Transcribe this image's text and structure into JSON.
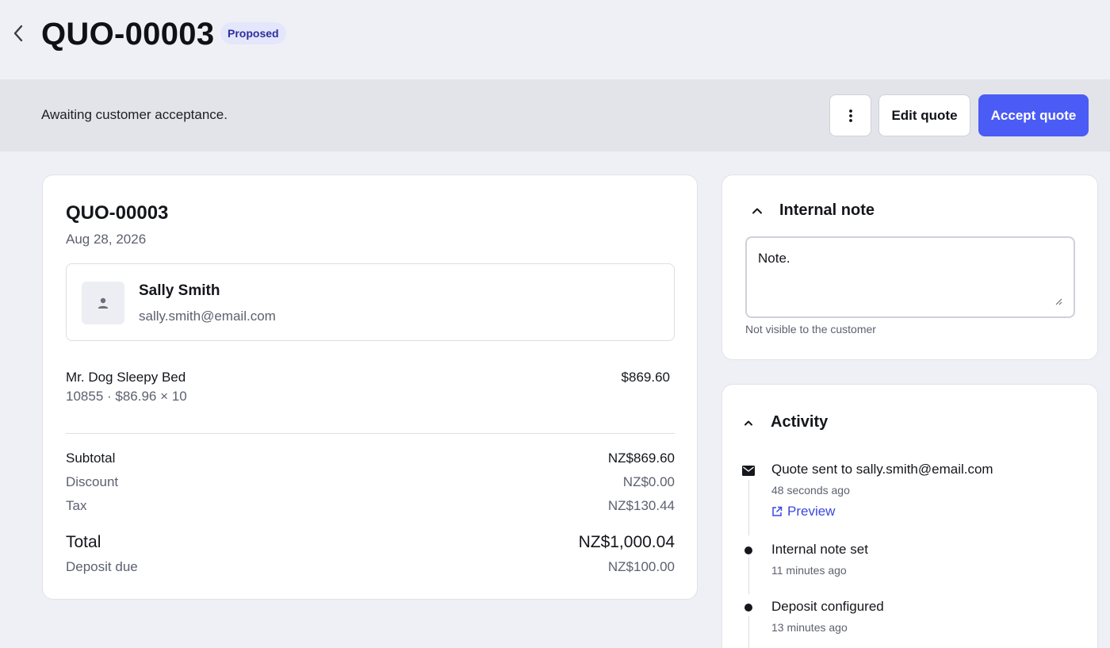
{
  "header": {
    "title": "QUO-00003",
    "status": "Proposed",
    "colors": {
      "badge_bg": "#e4e7fb",
      "badge_text": "#2b2f9e"
    }
  },
  "banner": {
    "message": "Awaiting customer acceptance.",
    "edit_label": "Edit quote",
    "accept_label": "Accept quote",
    "accent_color": "#4b5bf5"
  },
  "quote": {
    "number": "QUO-00003",
    "date": "Aug 28, 2026",
    "customer": {
      "name": "Sally Smith",
      "email": "sally.smith@email.com"
    },
    "line_item": {
      "name": "Mr. Dog Sleepy Bed",
      "meta": "10855 · $86.96 × 10",
      "price": "$869.60"
    },
    "summary": {
      "subtotal_label": "Subtotal",
      "subtotal_value": "NZ$869.60",
      "discount_label": "Discount",
      "discount_value": "NZ$0.00",
      "tax_label": "Tax",
      "tax_value": "NZ$130.44",
      "total_label": "Total",
      "total_value": "NZ$1,000.04",
      "deposit_label": "Deposit due",
      "deposit_value": "NZ$100.00"
    }
  },
  "internal_note": {
    "title": "Internal note",
    "value": "Note.",
    "help": "Not visible to the customer"
  },
  "activity": {
    "title": "Activity",
    "items": [
      {
        "icon": "mail-icon",
        "text": "Quote sent to sally.smith@email.com",
        "time": "48 seconds ago",
        "link": "Preview"
      },
      {
        "icon": "dot",
        "text": "Internal note set",
        "time": "11 minutes ago"
      },
      {
        "icon": "dot",
        "text": "Deposit configured",
        "time": "13 minutes ago"
      }
    ]
  }
}
